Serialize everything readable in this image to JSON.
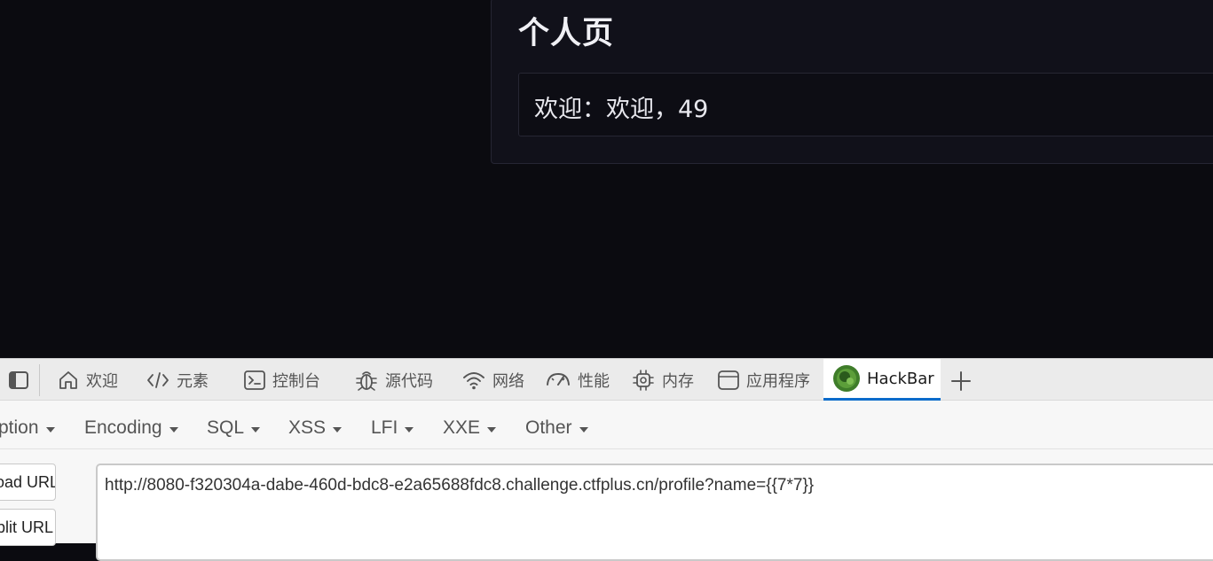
{
  "page": {
    "title": "个人页",
    "welcome_text": "欢迎：欢迎，49"
  },
  "devtools": {
    "tabs": [
      {
        "label": "欢迎",
        "icon": "home-icon"
      },
      {
        "label": "元素",
        "icon": "code-icon"
      },
      {
        "label": "控制台",
        "icon": "console-icon"
      },
      {
        "label": "源代码",
        "icon": "bug-icon"
      },
      {
        "label": "网络",
        "icon": "wifi-icon"
      },
      {
        "label": "性能",
        "icon": "gauge-icon"
      },
      {
        "label": "内存",
        "icon": "chip-icon"
      },
      {
        "label": "应用程序",
        "icon": "window-icon"
      },
      {
        "label": "HackBar",
        "icon": "hackbar-logo-icon",
        "active": true
      }
    ],
    "accent_color": "#0b6bcb"
  },
  "hackbar": {
    "menus": [
      "ption",
      "Encoding",
      "SQL",
      "XSS",
      "LFI",
      "XXE",
      "Other"
    ],
    "load_url_label": "oad URL",
    "split_url_label": "plit URL",
    "url_value": "http://8080-f320304a-dabe-460d-bdc8-e2a65688fdc8.challenge.ctfplus.cn/profile?name={{7*7}}"
  }
}
